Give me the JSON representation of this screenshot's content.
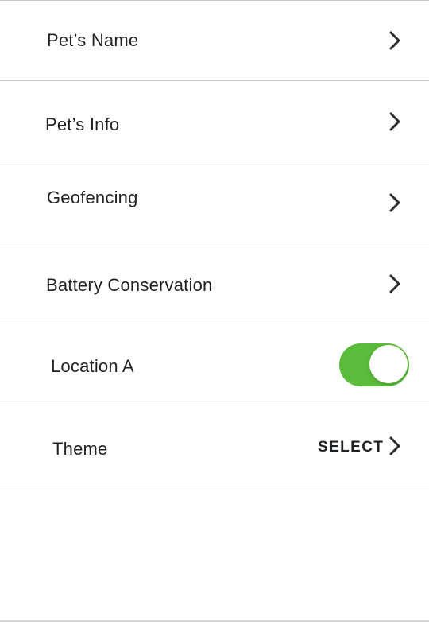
{
  "settings": {
    "items": [
      {
        "label": "Pet’s Name",
        "action": "chevron"
      },
      {
        "label": "Pet’s Info",
        "action": "chevron"
      },
      {
        "label": "Geofencing",
        "action": "chevron"
      },
      {
        "label": "Battery Conservation",
        "action": "chevron"
      },
      {
        "label": "Location A",
        "action": "toggle",
        "toggle_on": true
      },
      {
        "label": "Theme",
        "action": "select",
        "select_label": "SELECT"
      }
    ]
  },
  "colors": {
    "toggle_on": "#5bbb3b",
    "divider": "#c9c9c9",
    "text": "#1f2225"
  },
  "icons": {
    "chevron": "chevron-right-icon"
  }
}
